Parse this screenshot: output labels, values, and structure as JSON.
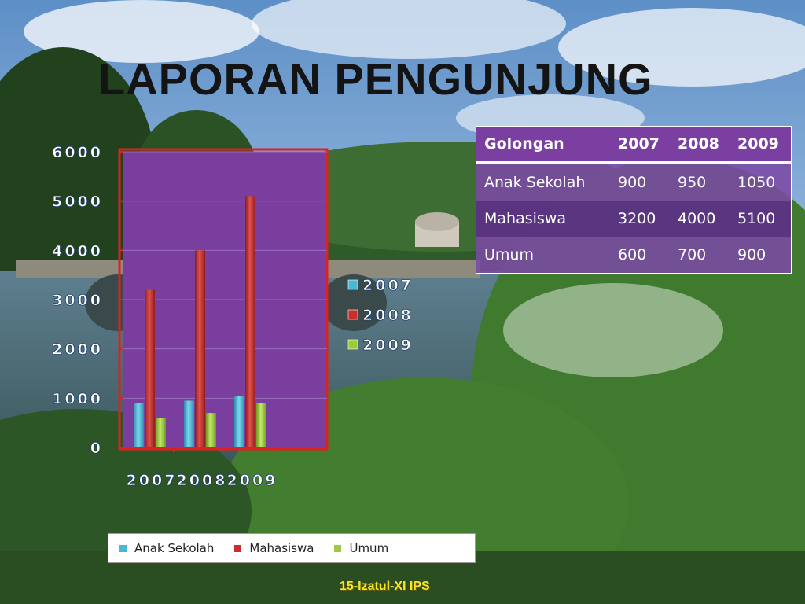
{
  "title": "LAPORAN PENGUNJUNG",
  "footer": "15-Izatul-XI IPS",
  "table": {
    "headers": [
      "Golongan",
      "2007",
      "2008",
      "2009"
    ],
    "rows": [
      [
        "Anak Sekolah",
        "900",
        "950",
        "1050"
      ],
      [
        "Mahasiswa",
        "3200",
        "4000",
        "5100"
      ],
      [
        "Umum",
        "600",
        "700",
        "900"
      ]
    ]
  },
  "colors": {
    "anak_sekolah": "#4ab8d2",
    "mahasiswa": "#c8302e",
    "umum": "#9ccc3a",
    "plot_area": "#7a3f9e",
    "frame": "#e02020"
  },
  "chart_data": {
    "type": "bar",
    "categories": [
      "2007",
      "2008",
      "2009"
    ],
    "series": [
      {
        "name": "Anak Sekolah",
        "values": [
          900,
          950,
          1050
        ]
      },
      {
        "name": "Mahasiswa",
        "values": [
          3200,
          4000,
          5100
        ]
      },
      {
        "name": "Umum",
        "values": [
          600,
          700,
          900
        ]
      }
    ],
    "yticks": [
      0,
      1000,
      2000,
      3000,
      4000,
      5000,
      6000
    ],
    "ylim": [
      0,
      6000
    ],
    "side_legend": [
      "2007",
      "2008",
      "2009"
    ],
    "grid": true,
    "legend_position": "bottom"
  }
}
